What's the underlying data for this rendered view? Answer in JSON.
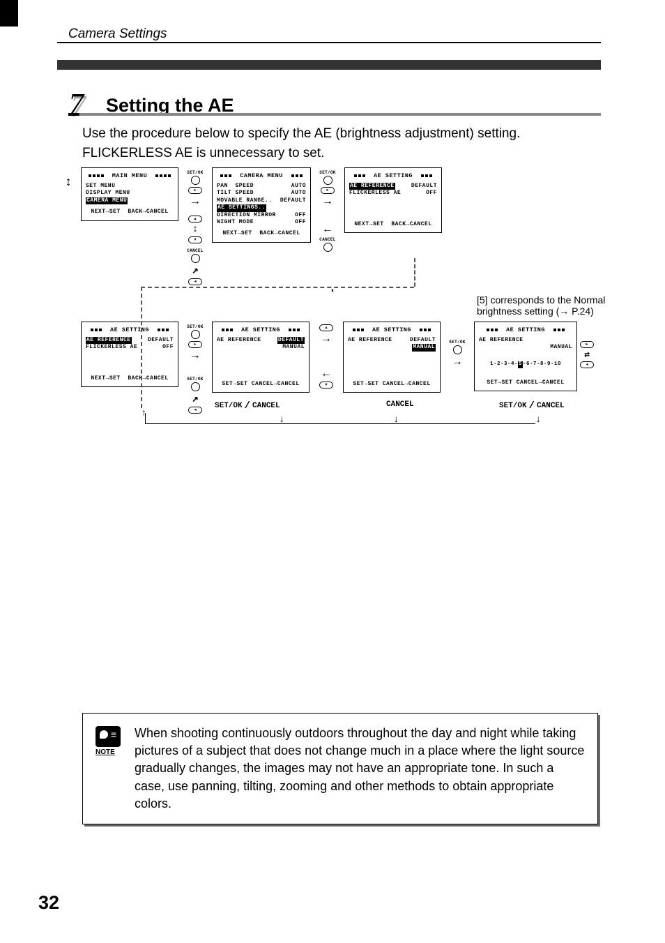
{
  "header": {
    "section": "Camera Settings"
  },
  "title": {
    "number": "7",
    "heading": "Setting the AE"
  },
  "intro": "Use the procedure below to specify the AE (brightness adjustment) setting. FLICKERLESS AE is unnecessary to set.",
  "labels": {
    "setok": "SET/OK",
    "cancel": "CANCEL",
    "next_set": "NEXT→SET",
    "back_cancel": "BACK→CANCEL",
    "set_set": "SET→SET",
    "cancel_cancel": "CANCEL→CANCEL"
  },
  "screens": {
    "main_menu": {
      "title": "MAIN  MENU",
      "items": [
        "SET MENU",
        "DISPLAY MENU",
        "CAMERA MENU"
      ],
      "highlighted": 2
    },
    "camera_menu": {
      "title": "CAMERA MENU",
      "lines": [
        {
          "l": "PAN  SPEED",
          "r": "AUTO"
        },
        {
          "l": "TILT SPEED",
          "r": "AUTO"
        },
        {
          "l": "MOVABLE RANGE..",
          "r": "DEFAULT"
        },
        {
          "l": "AE SETTINGS..",
          "r": "",
          "hl": true
        },
        {
          "l": "DIRECTION MIRROR",
          "r": "OFF"
        },
        {
          "l": "NIGHT MODE",
          "r": "OFF"
        }
      ]
    },
    "ae_setting_1": {
      "title": "AE SETTING",
      "lines": [
        {
          "l": "AE REFERENCE",
          "r": "DEFAULT",
          "hl_l": true
        },
        {
          "l": "FLICKERLESS AE",
          "r": "OFF"
        }
      ]
    },
    "ae_setting_2": {
      "title": "AE SETTING",
      "lines": [
        {
          "l": "AE REFERENCE",
          "r": "DEFAULT",
          "hl_l": true
        },
        {
          "l": "FLICKERLESS AE",
          "r": "OFF"
        }
      ]
    },
    "ae_setting_3": {
      "title": "AE SETTING",
      "lines": [
        {
          "l": "AE REFERENCE",
          "rlist": [
            "DEFAULT",
            "MANUAL"
          ],
          "hl_r": 0
        }
      ]
    },
    "ae_setting_4": {
      "title": "AE SETTING",
      "lines": [
        {
          "l": "AE REFERENCE",
          "rlist": [
            "DEFAULT",
            "MANUAL"
          ],
          "hl_r": 1
        }
      ]
    },
    "ae_setting_5": {
      "title": "AE SETTING",
      "lines": [
        {
          "l": "AE REFERENCE",
          "r": "MANUAL"
        }
      ],
      "scale": "1-2-3-4-5-6-7-8-9-10",
      "scale_sel": "5"
    }
  },
  "annotation": "[5] corresponds to the Normal brightness setting (→ P.24)",
  "note": {
    "label": "NOTE",
    "text": "When shooting continuously outdoors throughout the day and night while taking pictures of a subject that does not change much in a place where the light source gradually changes, the images may not have an appropriate tone. In such a case, use panning, tilting, zooming and other methods to obtain appropriate colors."
  },
  "page_number": "32"
}
